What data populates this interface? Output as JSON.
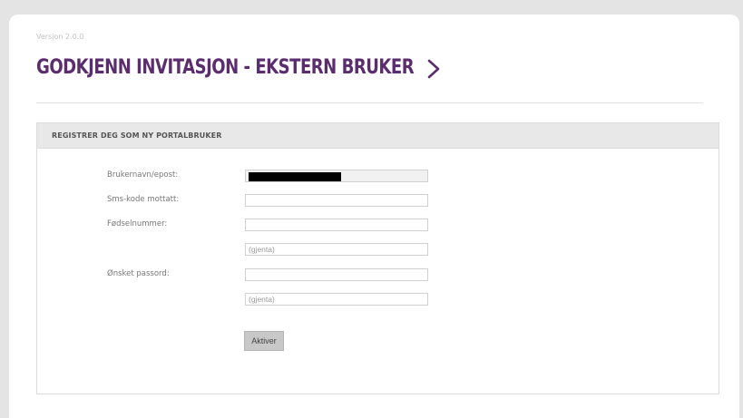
{
  "header": {
    "version": "Versjon 2.0.0",
    "title": "GODKJENN INVITASJON - EKSTERN BRUKER"
  },
  "panel": {
    "title": "REGISTRER DEG SOM NY PORTALBRUKER"
  },
  "form": {
    "username": {
      "label": "Brukernavn/epost:",
      "value": ""
    },
    "sms_code": {
      "label": "Sms-kode mottatt:",
      "value": ""
    },
    "ssn": {
      "label": "Fødselnummer:",
      "value": ""
    },
    "ssn_repeat": {
      "placeholder": "(gjenta)"
    },
    "password": {
      "label": "Ønsket passord:",
      "value": ""
    },
    "password_repeat": {
      "placeholder": "(gjenta)"
    },
    "submit_label": "Aktiver"
  },
  "icons": {
    "chevron": "chevron-right-icon"
  },
  "colors": {
    "title": "#5b2d6e",
    "page_background": "#e4e4e4",
    "panel_header": "#e8e8e8",
    "button": "#c8c8c8"
  }
}
